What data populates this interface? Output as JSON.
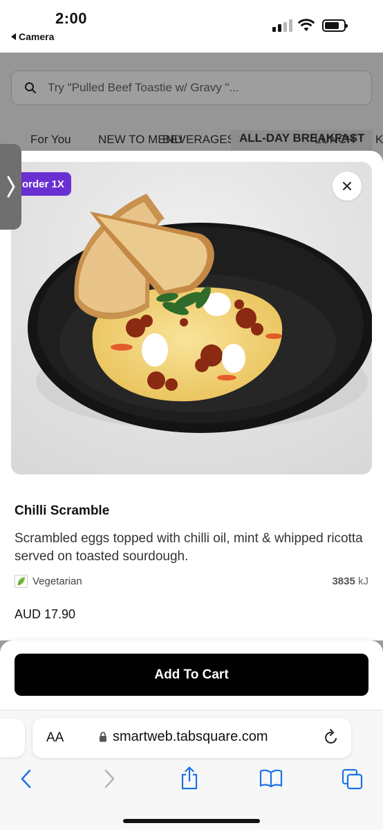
{
  "status_bar": {
    "time": "2:00",
    "back_app": "Camera"
  },
  "search": {
    "placeholder": "Try \"Pulled Beef Toastie w/ Gravy \"..."
  },
  "categories": [
    "For You",
    "NEW TO MENU",
    "BEVERAGES",
    "ALL-DAY BREAKFAST",
    "LUNCH",
    "K"
  ],
  "active_category": "ALL-DAY BREAKFAST",
  "item": {
    "badge": "order 1X",
    "name": "Chilli Scramble",
    "description": "Scrambled eggs topped with chilli oil, mint & whipped ricotta served on toasted sourdough.",
    "diet": "Vegetarian",
    "energy_value": "3835",
    "energy_unit": "kJ",
    "price": "AUD 17.90"
  },
  "cart": {
    "button_label": "Add To Cart"
  },
  "browser": {
    "aa_label": "AA",
    "url": "smartweb.tabsquare.com"
  },
  "icons": [
    "search-icon",
    "close-icon",
    "leaf-icon",
    "lock-icon",
    "reload-icon",
    "back-arrow-icon",
    "forward-arrow-icon",
    "share-icon",
    "bookmarks-icon",
    "tabs-icon"
  ],
  "colors": {
    "badge": "#6a2fd1",
    "button": "#000000",
    "browser_accent": "#1a73e8",
    "leaf": "#7cc04a"
  }
}
